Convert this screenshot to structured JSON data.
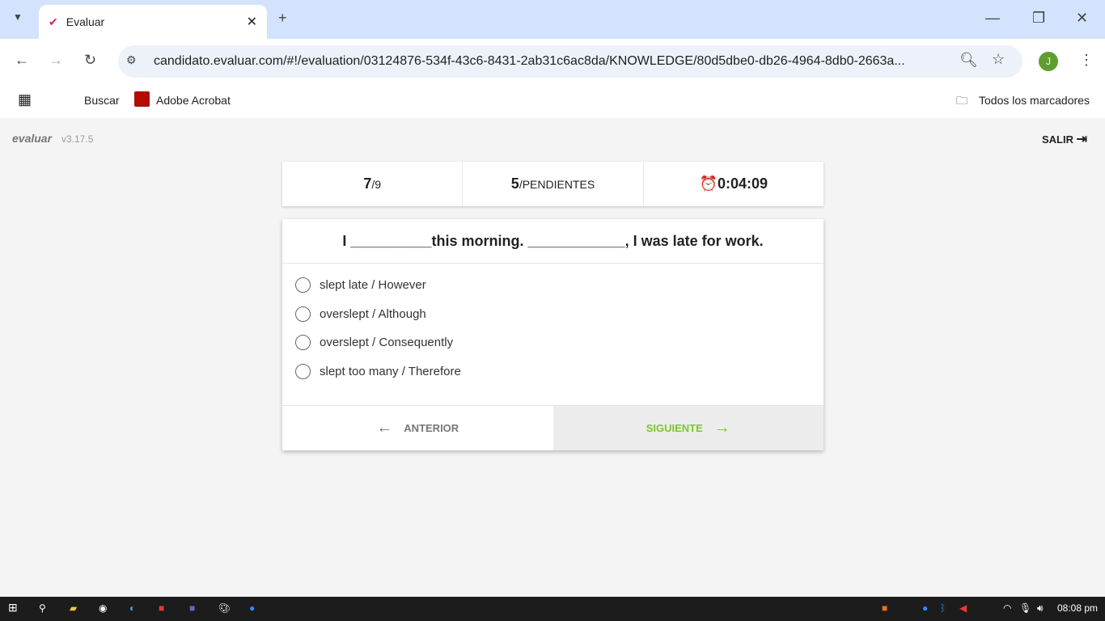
{
  "browser": {
    "tab_title": "Evaluar",
    "url": "candidato.evaluar.com/#!/evaluation/03124876-534f-43c6-8431-2ab31c6ac8da/KNOWLEDGE/80d5dbe0-db26-4964-8db0-2663a...",
    "profile_initial": "J",
    "bookmarks": [
      "Buscar",
      "Adobe Acrobat"
    ],
    "all_bookmarks": "Todos los marcadores"
  },
  "app": {
    "logo": "evaluar",
    "version": "v3.17.5",
    "exit_label": "SALIR",
    "stats": {
      "current": "7",
      "total": "/9",
      "pending_count": "5",
      "pending_label": "/PENDIENTES",
      "timer": "0:04:09"
    },
    "question": "I __________this morning. ____________, I was late for work.",
    "options": [
      "slept late / However",
      "overslept / Although",
      "overslept / Consequently",
      "slept too many / Therefore"
    ],
    "prev_label": "ANTERIOR",
    "next_label": "SIGUIENTE"
  },
  "taskbar": {
    "time": "08:08 pm"
  },
  "colors": {
    "accent_green": "#7cc62d",
    "pending_red": "#f44336"
  }
}
